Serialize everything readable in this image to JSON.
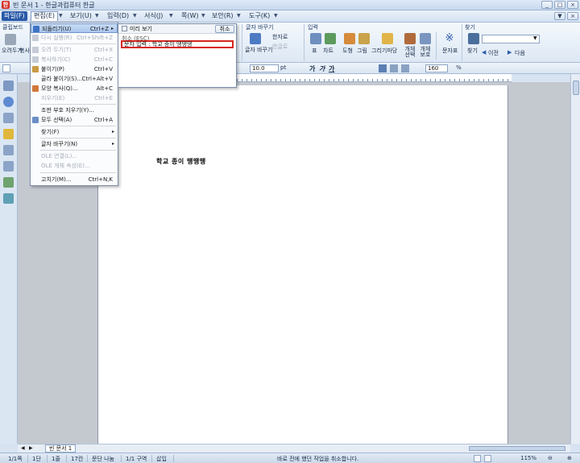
{
  "titlebar": {
    "title": "빈 문서 1 - 한글과컴퓨터 한글",
    "icon": "hwp-app-icon",
    "buttons": [
      "_",
      "□",
      "×"
    ]
  },
  "menubar": {
    "items": [
      "파일(F)",
      "편집(E)",
      "보기(U)",
      "입력(D)",
      "서식(J)",
      "쪽(W)",
      "보안(R)",
      "도구(K)"
    ],
    "active": "편집(E)",
    "right_buttons": [
      "▼",
      "×"
    ]
  },
  "ribbon": {
    "clipboard_label": "클립보드",
    "clipboard_items": [
      "오려두기",
      "복사"
    ],
    "find_replace_label": "글자 바꾸기",
    "find_replace_items": [
      "글자 바꾸기",
      "한자로",
      "한글로"
    ],
    "input_label": "입력",
    "input_items": [
      "표",
      "차트",
      "도형",
      "그림",
      "그리기마당",
      "개체 선택",
      "개체 보호",
      "문자표",
      "찾기"
    ],
    "find_label": "찾기",
    "find_nav": [
      "이전",
      "다음"
    ]
  },
  "formatbar": {
    "font_size": "10.0",
    "font_unit": "pt",
    "styles": [
      "가",
      "가",
      "가"
    ],
    "zoom": "160",
    "zoom_unit": "%"
  },
  "edit_menu": {
    "items": [
      {
        "label": "되돌리기(U)",
        "shortcut": "Ctrl+Z",
        "state": "highlight",
        "arrow": "▸"
      },
      {
        "label": "다시 실행(R)",
        "shortcut": "Ctrl+Shift+Z",
        "state": "disabled"
      },
      {
        "label": "오려 두기(T)",
        "shortcut": "Ctrl+X",
        "state": "disabled"
      },
      {
        "label": "복사하기(C)",
        "shortcut": "Ctrl+C",
        "state": "disabled"
      },
      {
        "label": "붙이기(P)",
        "shortcut": "Ctrl+V",
        "state": "normal"
      },
      {
        "label": "골라 붙이기(S)...",
        "shortcut": "Ctrl+Alt+V",
        "state": "normal"
      },
      {
        "label": "모양 복사(Q)...",
        "shortcut": "Alt+C",
        "state": "normal"
      },
      {
        "label": "지우기(E)",
        "shortcut": "Ctrl+E",
        "state": "disabled"
      },
      {
        "label": "조판 부호 지우기(Y)...",
        "shortcut": "",
        "state": "normal"
      },
      {
        "label": "모두 선택(A)",
        "shortcut": "Ctrl+A",
        "state": "normal"
      },
      {
        "label": "찾기(F)",
        "shortcut": "",
        "state": "normal",
        "arrow": "▸"
      },
      {
        "label": "글자 바꾸기(N)",
        "shortcut": "",
        "state": "normal",
        "arrow": "▸"
      },
      {
        "label": "OLE 연결(L)...",
        "shortcut": "",
        "state": "disabled"
      },
      {
        "label": "OLE 개체 속성(E)...",
        "shortcut": "",
        "state": "disabled"
      },
      {
        "label": "고치기(M)...",
        "shortcut": "Ctrl+N,K",
        "state": "normal"
      }
    ]
  },
  "undo_panel": {
    "preview_label": "미리 보기",
    "cancel_label": "취소",
    "first_entry": "취소 (ESC)",
    "selected_entry": "문자 입력 : 학교 종이 땡땡땡"
  },
  "document": {
    "text": "학교 종이 땡땡땡",
    "tab_label": "빈 문서 1"
  },
  "statusbar": {
    "items": [
      "1/1쪽",
      "1단",
      "1줄",
      "17칸",
      "문단 나눔",
      "1/1 구역",
      "삽입"
    ],
    "message": "바로 전에 했던 작업을 취소합니다.",
    "zoom": "115%"
  },
  "colors": {
    "accent": "#2a5aa8",
    "highlight_border": "#d6271d",
    "app_icon": "#d9332b"
  }
}
